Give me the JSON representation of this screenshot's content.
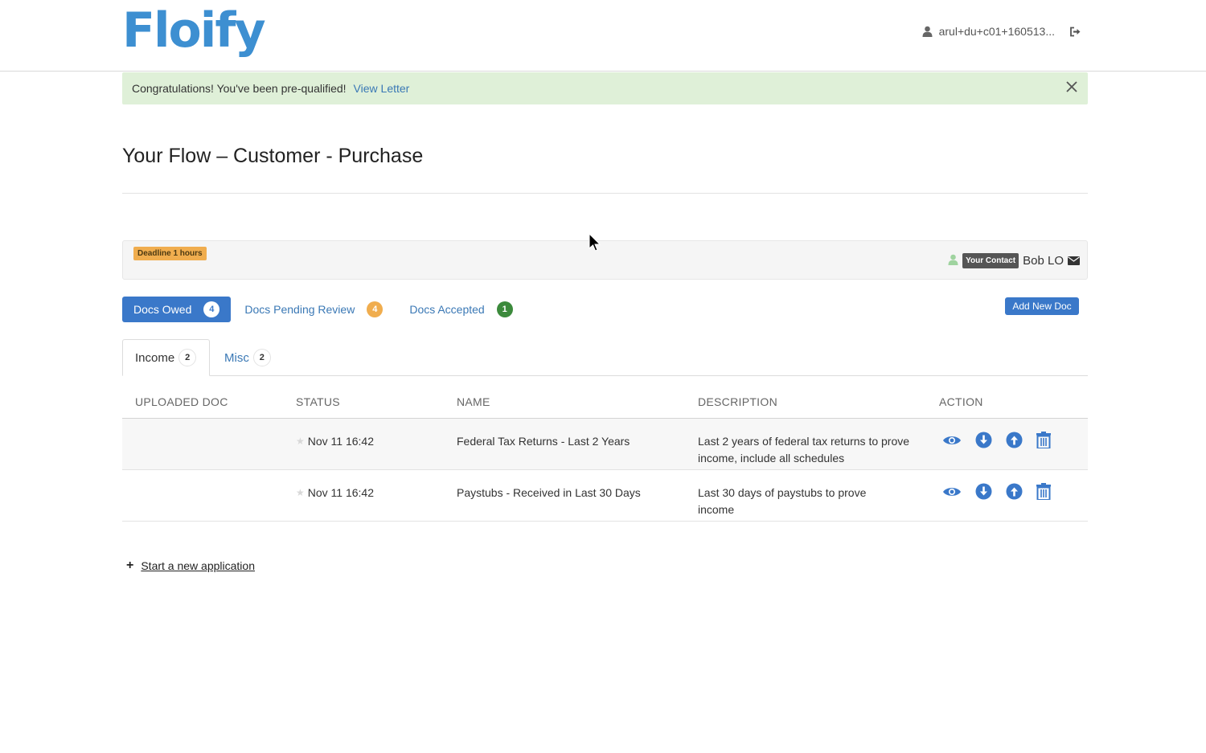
{
  "header": {
    "logo_text": "Floify",
    "username": "arul+du+c01+160513...",
    "icons": [
      "user-icon",
      "logout-icon"
    ]
  },
  "alert": {
    "message": "Congratulations! You've been pre-qualified!",
    "link": "View Letter"
  },
  "page": {
    "title": "Your Flow – Customer - Purchase"
  },
  "infobar": {
    "deadline": "Deadline 1 hours",
    "contact_badge": "Your Contact",
    "contact_name": "Bob LO"
  },
  "tabs": [
    {
      "label": "Docs Owed",
      "count": "4"
    },
    {
      "label": "Docs Pending Review",
      "count": "4"
    },
    {
      "label": "Docs Accepted",
      "count": "1"
    }
  ],
  "add_doc_label": "Add New Doc",
  "subtabs": [
    {
      "label": "Income",
      "count": "2"
    },
    {
      "label": "Misc",
      "count": "2"
    }
  ],
  "table": {
    "headers": [
      "UPLOADED DOC",
      "STATUS",
      "NAME",
      "DESCRIPTION",
      "ACTION"
    ],
    "rows": [
      {
        "uploaded": "",
        "status": "Nov 11 16:42",
        "name": "Federal Tax Returns - Last 2 Years",
        "description": "Last 2 years of federal tax returns to prove income, include all schedules"
      },
      {
        "uploaded": "",
        "status": "Nov 11 16:42",
        "name": "Paystubs - Received in Last 30 Days",
        "description": "Last 30 days of paystubs to prove income"
      }
    ],
    "action_icons": [
      "view-icon",
      "download-icon",
      "upload-icon",
      "trash-icon"
    ]
  },
  "new_application": "Start a new application",
  "colors": {
    "brand_blue": "#3a78c9",
    "logo_blue": "#3d8fd1",
    "alert_green": "#dff0d8",
    "badge_orange": "#f0ad4e",
    "badge_green": "#3c8a3c"
  }
}
